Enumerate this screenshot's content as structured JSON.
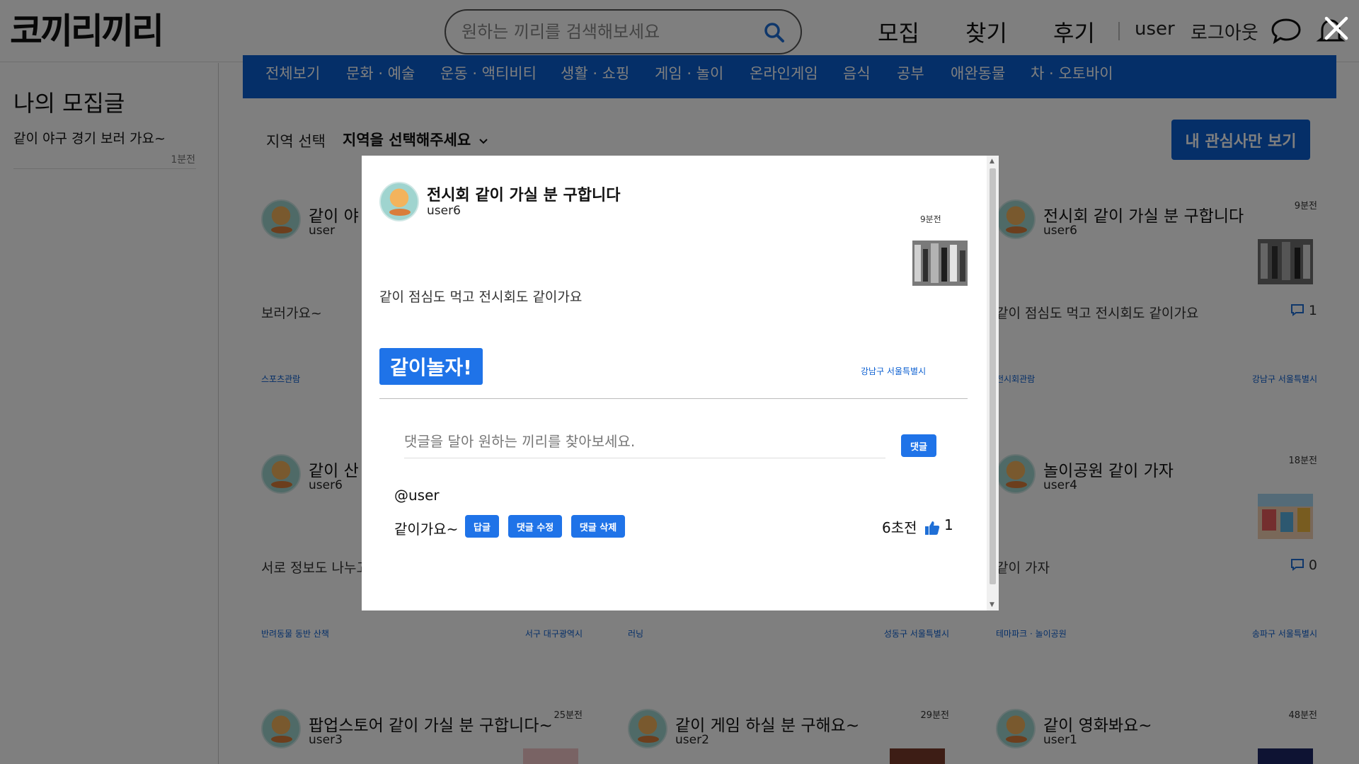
{
  "header": {
    "logo": "코끼리끼리",
    "search_placeholder": "원하는 끼리를 검색해보세요",
    "nav": [
      "모집",
      "찾기",
      "후기"
    ],
    "username": "user",
    "logout": "로그아웃"
  },
  "sidebar": {
    "title": "나의 모집글",
    "post_title": "같이 야구 경기 보러 가요~",
    "post_time": "1분전"
  },
  "categories": [
    "전체보기",
    "문화 · 예술",
    "운동 · 액티비티",
    "생활 · 쇼핑",
    "게임 · 놀이",
    "온라인게임",
    "음식",
    "공부",
    "애완동물",
    "차 · 오토바이"
  ],
  "filter": {
    "region_label": "지역 선택",
    "region_select": "지역을 선택해주세요",
    "interest_button": "내 관심사만 보기"
  },
  "cards": [
    {
      "title": "같이 야",
      "user": "user",
      "time": "",
      "body": "보러가요~",
      "comments": "",
      "tag": "스포츠관람",
      "loc": ""
    },
    {
      "title": "전시회 같이 가실 분 구합니다",
      "user": "user6",
      "time": "9분전",
      "body": "같이 점심도 먹고 전시회도 같이가요",
      "comments": "1",
      "tag": "전시회관람",
      "loc": "강남구  서울특별시"
    },
    {
      "title": "같이 산",
      "user": "user6",
      "time": "",
      "body": "서로 정보도 나누고",
      "comments": "",
      "tag": "반려동물 동반 산책",
      "loc": "서구  대구광역시"
    },
    {
      "title": "",
      "user": "",
      "time": "",
      "body": "",
      "comments": "",
      "tag": "러닝",
      "loc": "성동구  서울특별시"
    },
    {
      "title": "놀이공원 같이 가자",
      "user": "user4",
      "time": "18분전",
      "body": "같이 가자",
      "comments": "0",
      "tag": "테마파크 · 놀이공원",
      "loc": "송파구  서울특별시"
    },
    {
      "title": "팝업스토어 같이 가실 분 구합니다~",
      "user": "user3",
      "time": "25분전",
      "body": "",
      "comments": "",
      "tag": "",
      "loc": ""
    },
    {
      "title": "같이 게임 하실 분 구해요~",
      "user": "user2",
      "time": "29분전",
      "body": "",
      "comments": "",
      "tag": "",
      "loc": ""
    },
    {
      "title": "같이 영화봐요~",
      "user": "user1",
      "time": "48분전",
      "body": "",
      "comments": "",
      "tag": "",
      "loc": ""
    }
  ],
  "modal": {
    "title": "전시회 같이 가실 분 구합니다",
    "user": "user6",
    "time": "9분전",
    "body": "같이 점심도 먹고 전시회도 같이가요",
    "join_button": "같이놀자!",
    "location": "강남구  서울특별시",
    "comment_placeholder": "댓글을 달아 원하는 끼리를 찾아보세요.",
    "comment_submit": "댓글",
    "comment": {
      "author": "@user",
      "text": "같이가요~",
      "reply": "답글",
      "edit": "댓글 수정",
      "delete": "댓글 삭제",
      "time": "6초전",
      "likes": "1"
    }
  },
  "icons": [
    "search-icon",
    "chat-icon",
    "bell-icon",
    "close-icon",
    "comment-icon",
    "thumbs-up-icon",
    "chevron-down-icon"
  ],
  "colors": {
    "accent": "#0b5fd1",
    "button": "#1f73e8",
    "overlay": "rgba(0,0,0,0.5)"
  }
}
